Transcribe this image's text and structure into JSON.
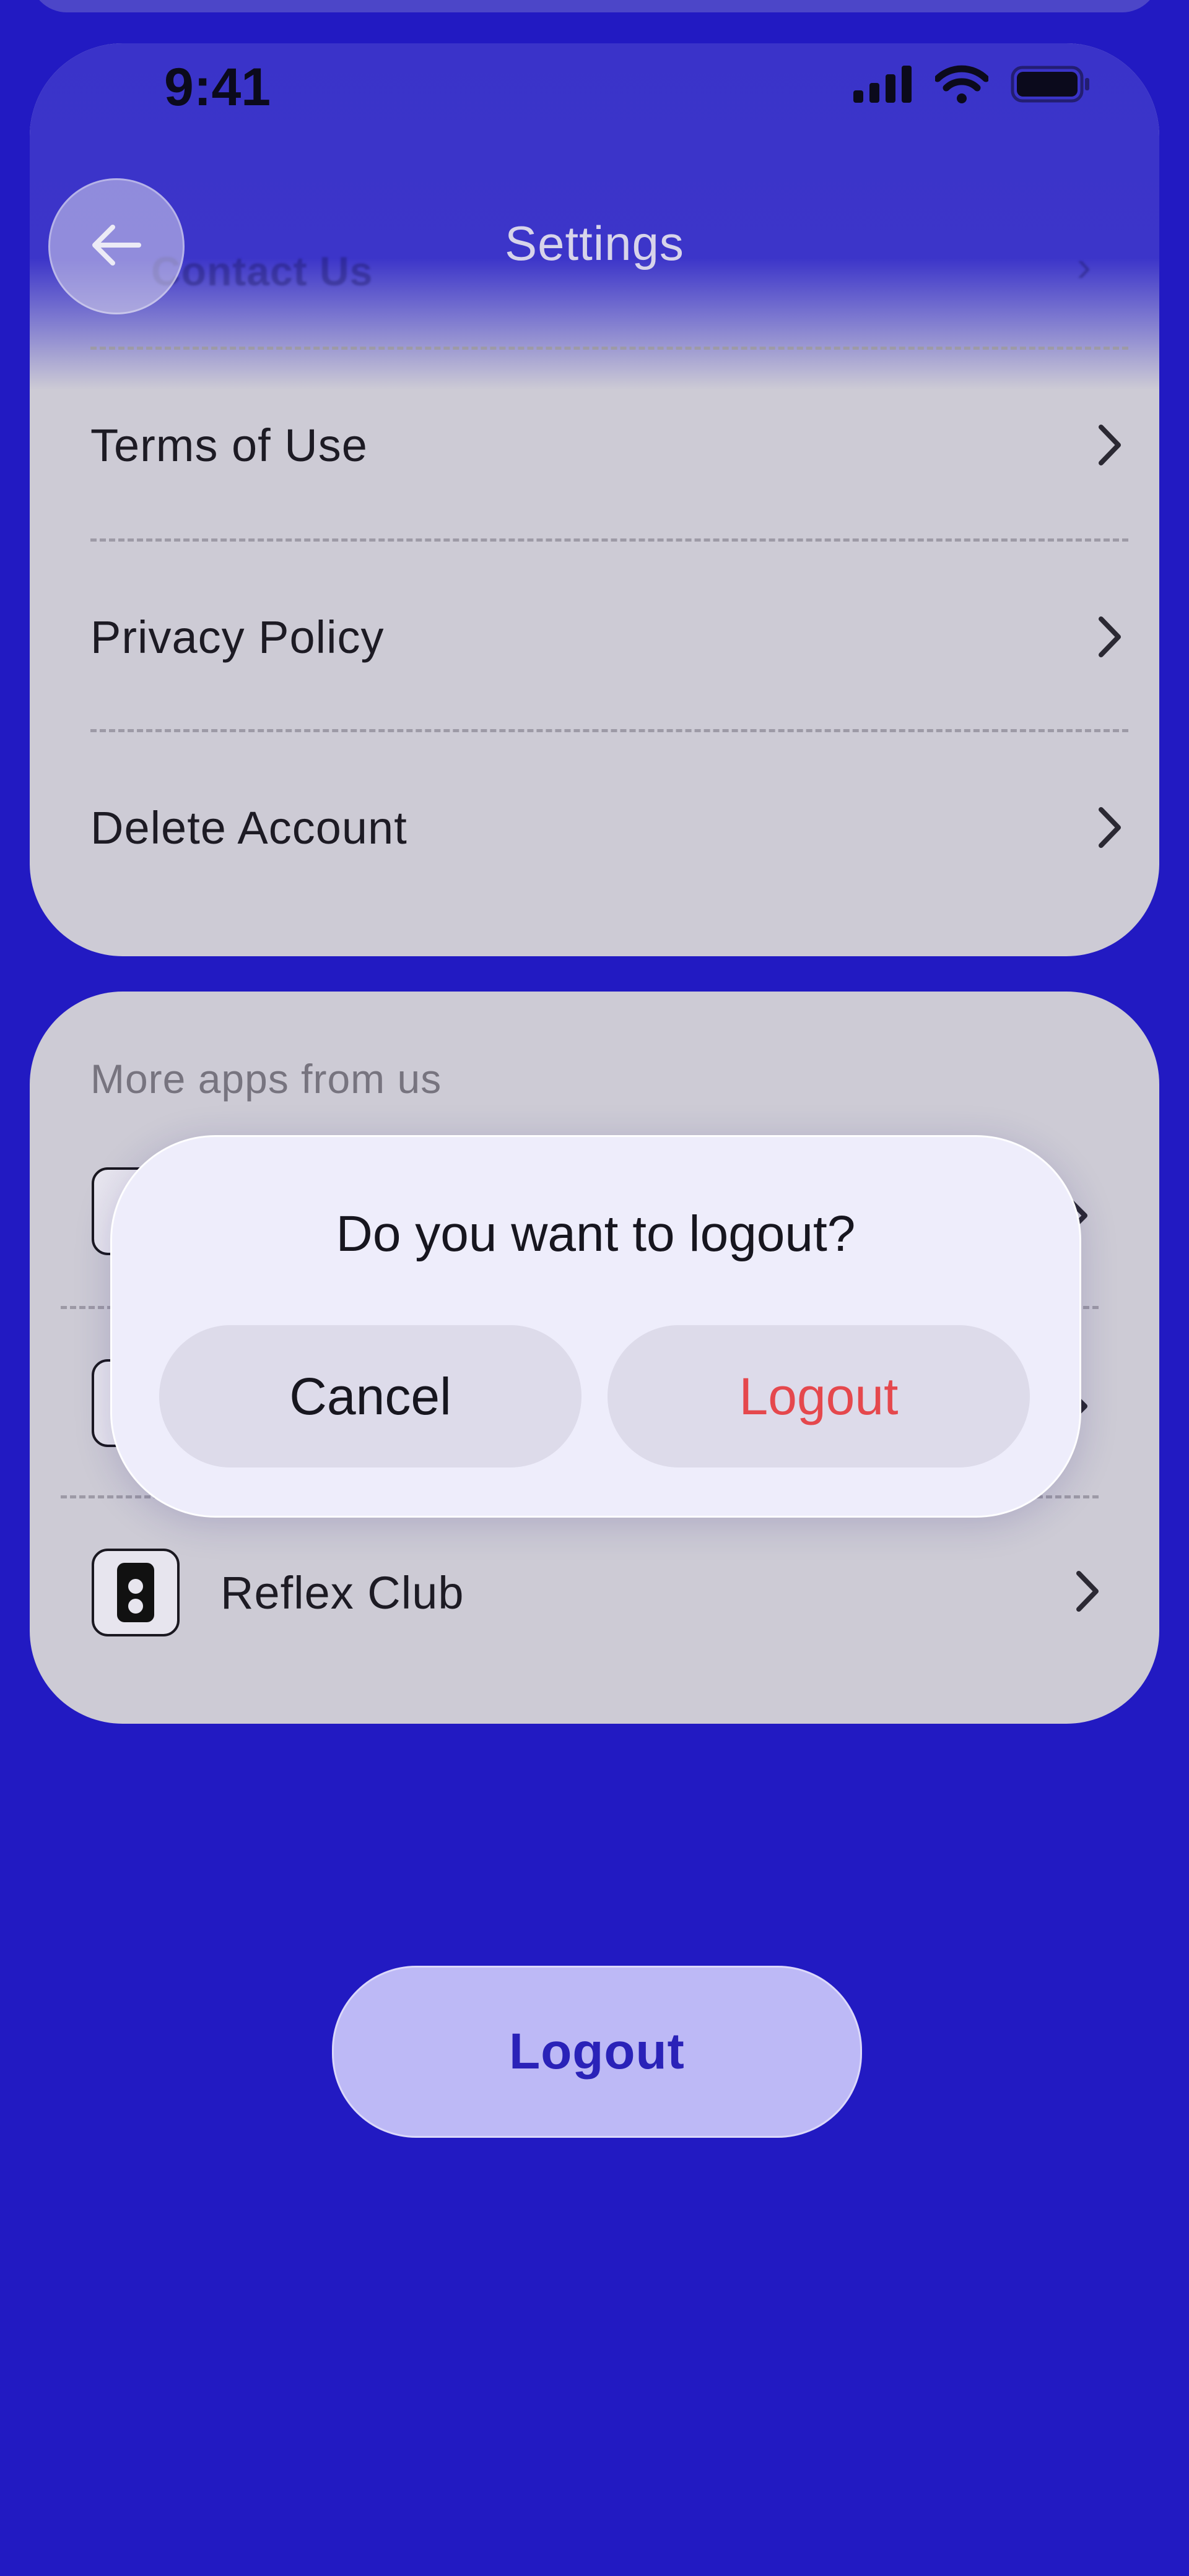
{
  "status_bar": {
    "time": "9:41"
  },
  "nav": {
    "title": "Settings",
    "ghost_row_label": "Contact Us"
  },
  "settings_rows": [
    {
      "label": "Terms of Use"
    },
    {
      "label": "Privacy Policy"
    },
    {
      "label": "Delete Account"
    }
  ],
  "apps_section": {
    "title": "More apps from us",
    "items": [
      {
        "label": "Reflex Club"
      }
    ]
  },
  "dialog": {
    "title": "Do you want to logout?",
    "cancel_label": "Cancel",
    "confirm_label": "Logout"
  },
  "logout_button": {
    "label": "Logout"
  },
  "colors": {
    "background": "#221ac2",
    "card": "#cdcbd5",
    "destructive": "#e5484d",
    "primary": "#2a22b8",
    "logout_button_bg": "#bdb9f6"
  }
}
